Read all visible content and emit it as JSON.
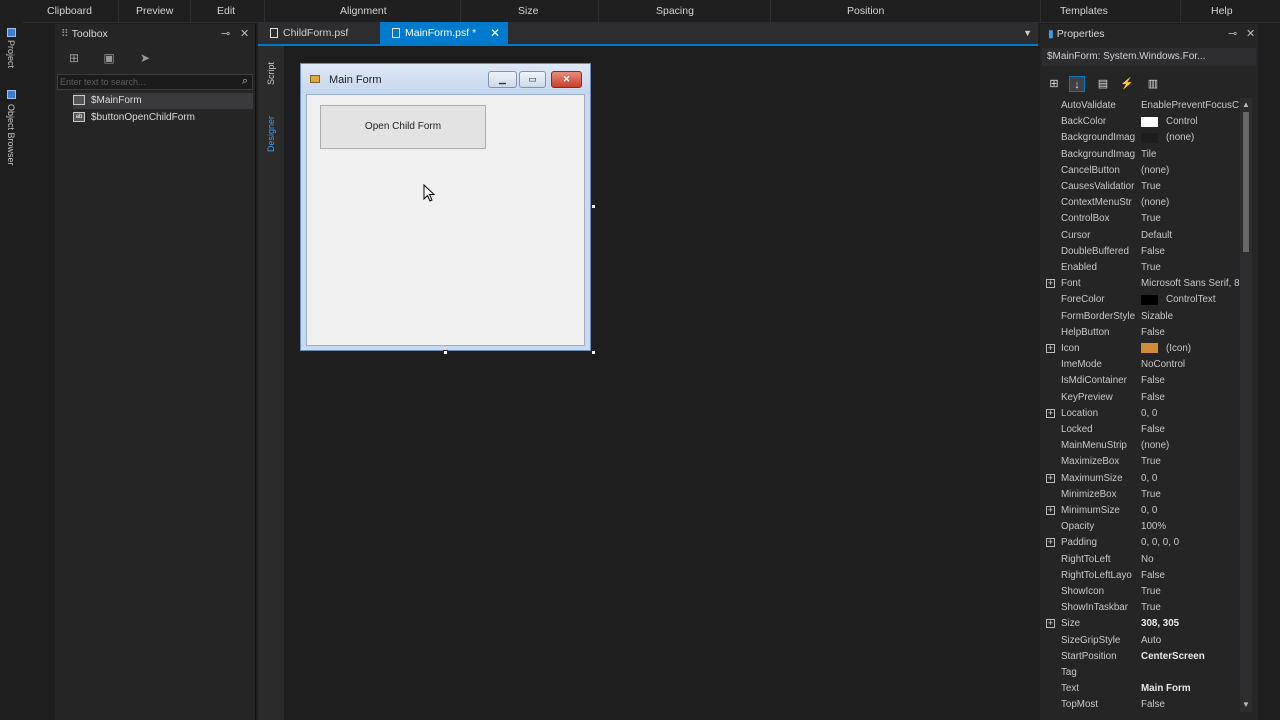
{
  "ribbon": {
    "groups": [
      "Clipboard",
      "Preview",
      "Edit",
      "Alignment",
      "Size",
      "Spacing",
      "Position",
      "Templates",
      "Help"
    ]
  },
  "left_strip": {
    "tabs": [
      "Project",
      "Object Browser"
    ]
  },
  "toolbox": {
    "title": "Toolbox",
    "search_placeholder": "Enter text to search...",
    "items": [
      "$MainForm",
      "$buttonOpenChildForm"
    ]
  },
  "document_tabs": [
    {
      "label": "ChildForm.psf"
    },
    {
      "label": "MainForm.psf *"
    }
  ],
  "designer_side_tabs": [
    "Script",
    "Designer"
  ],
  "form": {
    "title": "Main Form",
    "button_label": "Open Child Form"
  },
  "properties": {
    "title": "Properties",
    "selector": "$MainForm: System.Windows.For...",
    "rows": [
      {
        "name": "AutoValidate",
        "value": "EnablePreventFocusC"
      },
      {
        "name": "BackColor",
        "value": "Control",
        "swatch": "#ffffff"
      },
      {
        "name": "BackgroundImag",
        "value": "(none)",
        "swatch": "#1e1e1e"
      },
      {
        "name": "BackgroundImag",
        "value": "Tile"
      },
      {
        "name": "CancelButton",
        "value": "(none)"
      },
      {
        "name": "CausesValidatior",
        "value": "True"
      },
      {
        "name": "ContextMenuStr",
        "value": "(none)"
      },
      {
        "name": "ControlBox",
        "value": "True"
      },
      {
        "name": "Cursor",
        "value": "Default"
      },
      {
        "name": "DoubleBuffered",
        "value": "False"
      },
      {
        "name": "Enabled",
        "value": "True"
      },
      {
        "name": "Font",
        "value": "Microsoft Sans Serif, 8",
        "expander": "+"
      },
      {
        "name": "ForeColor",
        "value": "ControlText",
        "swatch": "#000000"
      },
      {
        "name": "FormBorderStyle",
        "value": "Sizable"
      },
      {
        "name": "HelpButton",
        "value": "False"
      },
      {
        "name": "Icon",
        "value": "(Icon)",
        "expander": "+",
        "swatch": "#d08a3a"
      },
      {
        "name": "ImeMode",
        "value": "NoControl"
      },
      {
        "name": "IsMdiContainer",
        "value": "False"
      },
      {
        "name": "KeyPreview",
        "value": "False"
      },
      {
        "name": "Location",
        "value": "0, 0",
        "expander": "+"
      },
      {
        "name": "Locked",
        "value": "False"
      },
      {
        "name": "MainMenuStrip",
        "value": "(none)"
      },
      {
        "name": "MaximizeBox",
        "value": "True"
      },
      {
        "name": "MaximumSize",
        "value": "0, 0",
        "expander": "+"
      },
      {
        "name": "MinimizeBox",
        "value": "True"
      },
      {
        "name": "MinimumSize",
        "value": "0, 0",
        "expander": "+"
      },
      {
        "name": "Opacity",
        "value": "100%"
      },
      {
        "name": "Padding",
        "value": "0, 0, 0, 0",
        "expander": "+"
      },
      {
        "name": "RightToLeft",
        "value": "No"
      },
      {
        "name": "RightToLeftLayo",
        "value": "False"
      },
      {
        "name": "ShowIcon",
        "value": "True"
      },
      {
        "name": "ShowInTaskbar",
        "value": "True"
      },
      {
        "name": "Size",
        "value": "308, 305",
        "expander": "+",
        "bold": true
      },
      {
        "name": "SizeGripStyle",
        "value": "Auto"
      },
      {
        "name": "StartPosition",
        "value": "CenterScreen",
        "bold": true
      },
      {
        "name": "Tag",
        "value": ""
      },
      {
        "name": "Text",
        "value": "Main Form",
        "bold": true
      },
      {
        "name": "TopMost",
        "value": "False"
      }
    ]
  }
}
